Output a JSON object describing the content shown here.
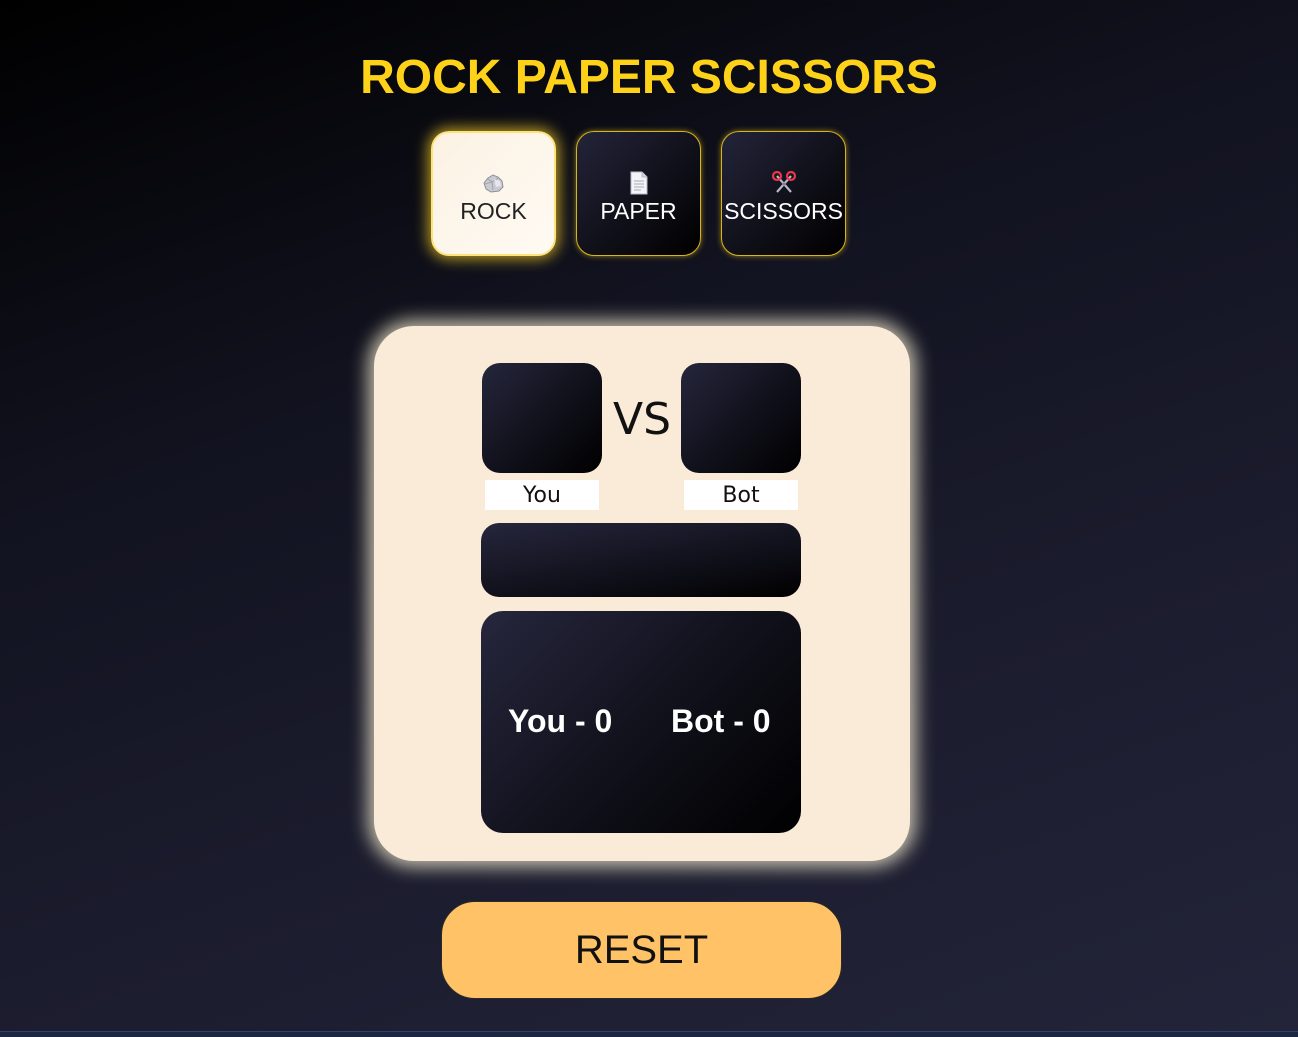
{
  "title": "ROCK PAPER SCISSORS",
  "choices": [
    {
      "label": "ROCK",
      "icon": "rock-icon",
      "selected": true
    },
    {
      "label": "PAPER",
      "icon": "paper-icon",
      "selected": false
    },
    {
      "label": "SCISSORS",
      "icon": "scissors-icon",
      "selected": false
    }
  ],
  "board": {
    "vs": "VS",
    "player_label": "You",
    "bot_label": "Bot",
    "result_text": ""
  },
  "score": {
    "player": "You - 0",
    "bot": "Bot - 0"
  },
  "reset_label": "RESET",
  "colors": {
    "title": "#ffd21a",
    "card": "#faebd9",
    "reset": "#ffc266",
    "choice_border": "#d8b51a"
  }
}
